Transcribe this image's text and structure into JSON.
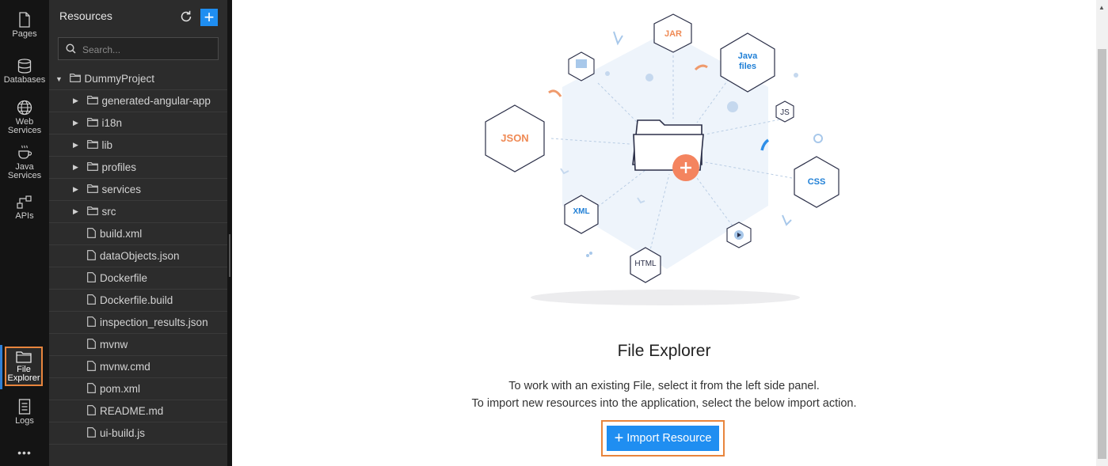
{
  "rail": {
    "items": [
      {
        "label": "Pages"
      },
      {
        "label": "Databases"
      },
      {
        "label": "Web Services",
        "line1": "Web",
        "line2": "Services"
      },
      {
        "label": "Java Services",
        "line1": "Java",
        "line2": "Services"
      },
      {
        "label": "APIs"
      },
      {
        "label": "File Explorer",
        "line1": "File",
        "line2": "Explorer"
      },
      {
        "label": "Logs"
      },
      {
        "label": "•••"
      }
    ]
  },
  "panel": {
    "title": "Resources",
    "add_label": "+",
    "search_placeholder": "Search...",
    "tree": [
      {
        "name": "DummyProject",
        "type": "folder",
        "expanded": true,
        "level": 0
      },
      {
        "name": "generated-angular-app",
        "type": "folder",
        "level": 1
      },
      {
        "name": "i18n",
        "type": "folder",
        "level": 1
      },
      {
        "name": "lib",
        "type": "folder",
        "level": 1
      },
      {
        "name": "profiles",
        "type": "folder",
        "level": 1
      },
      {
        "name": "services",
        "type": "folder",
        "level": 1
      },
      {
        "name": "src",
        "type": "folder",
        "level": 1
      },
      {
        "name": "build.xml",
        "type": "file",
        "level": 1
      },
      {
        "name": "dataObjects.json",
        "type": "file",
        "level": 1
      },
      {
        "name": "Dockerfile",
        "type": "file",
        "level": 1
      },
      {
        "name": "Dockerfile.build",
        "type": "file",
        "level": 1
      },
      {
        "name": "inspection_results.json",
        "type": "file",
        "level": 1
      },
      {
        "name": "mvnw",
        "type": "file",
        "level": 1
      },
      {
        "name": "mvnw.cmd",
        "type": "file",
        "level": 1
      },
      {
        "name": "pom.xml",
        "type": "file",
        "level": 1
      },
      {
        "name": "README.md",
        "type": "file",
        "level": 1
      },
      {
        "name": "ui-build.js",
        "type": "file",
        "level": 1
      }
    ]
  },
  "illustration": {
    "badges": {
      "jar": "JAR",
      "java_line1": "Java",
      "java_line2": "files",
      "json": "JSON",
      "js": "JS",
      "css": "CSS",
      "xml": "XML",
      "html": "HTML"
    }
  },
  "main": {
    "title": "File Explorer",
    "line1": "To work with an existing File, select it from the left side panel.",
    "line2": "To import new resources into the application, select the below import action.",
    "import_label": "Import Resource"
  },
  "colors": {
    "accent_blue": "#1f8ef1",
    "highlight_orange": "#e8853d",
    "panel_bg": "#2c2c2c",
    "rail_bg": "#141414"
  }
}
